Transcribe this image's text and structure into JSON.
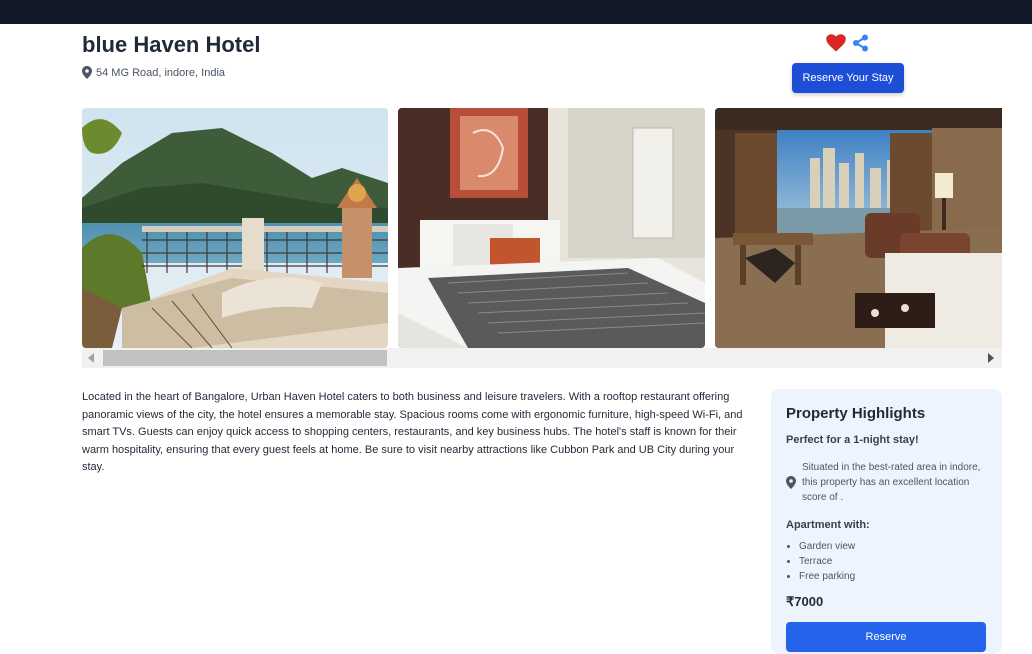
{
  "hotel": {
    "name": "blue Haven Hotel",
    "address": "54 MG Road, indore, India",
    "reserve_label": "Reserve Your Stay"
  },
  "icons": {
    "favorite": "heart-icon",
    "share": "share-icon",
    "location": "map-pin-icon"
  },
  "gallery": {
    "photos": [
      "balcony-lake-view",
      "bedroom-suite",
      "city-view-room"
    ]
  },
  "description": "Located in the heart of Bangalore, Urban Haven Hotel caters to both business and leisure travelers. With a rooftop restaurant offering panoramic views of the city, the hotel ensures a memorable stay. Spacious rooms come with ergonomic furniture, high-speed Wi-Fi, and smart TVs. Guests can enjoy quick access to shopping centers, restaurants, and key business hubs. The hotel's staff is known for their warm hospitality, ensuring that every guest feels at home. Be sure to visit nearby attractions like Cubbon Park and UB City during your stay.",
  "highlights": {
    "title": "Property Highlights",
    "subtitle": "Perfect for a 1-night stay!",
    "location_text": "Situated in the best-rated area in indore, this property has an excellent location score of .",
    "apartment_heading": "Apartment with:",
    "amenities": [
      "Garden view",
      "Terrace",
      "Free parking"
    ],
    "price": "₹7000",
    "reserve_label": "Reserve"
  },
  "colors": {
    "topbar": "#111827",
    "primary": "#1d4ed8",
    "heart": "#dc2626",
    "share": "#3b82f6",
    "panel_bg": "#eef4fe"
  }
}
